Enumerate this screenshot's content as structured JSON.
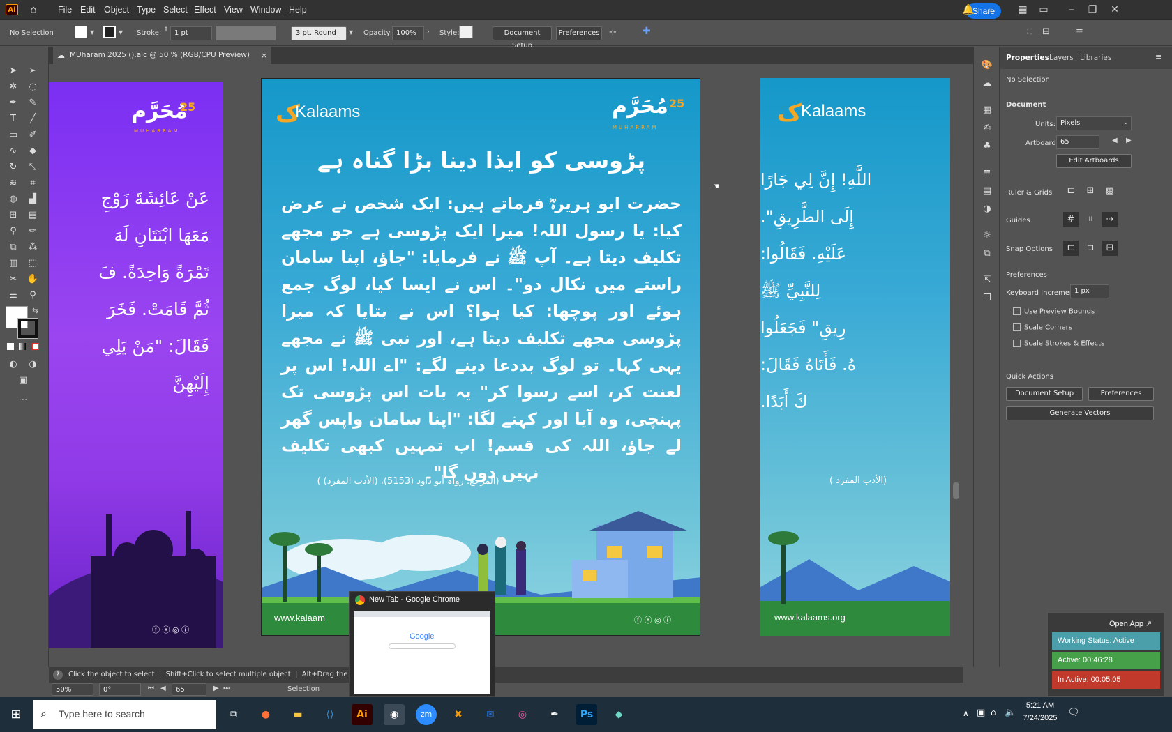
{
  "app": {
    "logo": "Ai",
    "menus": [
      "File",
      "Edit",
      "Object",
      "Type",
      "Select",
      "Effect",
      "View",
      "Window",
      "Help"
    ],
    "share_label": "Share"
  },
  "control": {
    "selection": "No Selection",
    "stroke_label": "Stroke:",
    "stroke_value": "1 pt",
    "brush": "3 pt. Round",
    "opacity_label": "Opacity:",
    "opacity_value": "100%",
    "style_label": "Style:",
    "doc_setup": "Document Setup",
    "preferences": "Preferences"
  },
  "document_tab": {
    "title": "MUharam 2025 ().aic @ 50 % (RGB/CPU Preview)",
    "close": "×"
  },
  "props": {
    "tabs": [
      "Properties",
      "Layers",
      "Libraries"
    ],
    "selection": "No Selection",
    "document": "Document",
    "units_label": "Units:",
    "units_value": "Pixels",
    "artboard_label": "Artboard:",
    "artboard_value": "65",
    "edit_artboards": "Edit Artboards",
    "ruler_grids": "Ruler & Grids",
    "guides": "Guides",
    "snap_options": "Snap Options",
    "preferences": "Preferences",
    "kb_inc_label": "Keyboard Increment:",
    "kb_inc_value": "1 px",
    "use_preview_bounds": "Use Preview Bounds",
    "scale_corners": "Scale Corners",
    "scale_strokes": "Scale Strokes & Effects",
    "quick_actions": "Quick Actions",
    "doc_setup_btn": "Document Setup",
    "prefs_btn": "Preferences",
    "gen_vectors": "Generate Vectors"
  },
  "artboard": {
    "brand": "Kalaams",
    "muharram_num": "25",
    "muharram_ar": "مُحَرَّم",
    "muharram_en": "MUHARRAM",
    "heading": "پڑوسی کو ایذا دینا بڑا گناہ ہے",
    "body": "حضرت ابو ہریرہؓ فرماتے ہیں: ایک شخص نے عرض کیا: یا رسول اللہ! میرا ایک پڑوسی ہے جو مجھے تکلیف دیتا ہے۔ آپ ﷺ نے فرمایا: \"جاؤ، اپنا سامان راستے میں نکال دو\"۔ اس نے ایسا کیا، لوگ جمع ہوئے اور پوچھا: کیا ہوا؟ اس نے بتایا کہ میرا پڑوسی مجھے تکلیف دیتا ہے، اور نبی ﷺ نے مجھے یہی کہا۔ تو لوگ بددعا دینے لگے: \"اے اللہ! اس پر لعنت کر، اسے رسوا کر\" یہ بات اس پڑوسی تک پہنچی، وہ آیا اور کہنے لگا: \"اپنا سامان واپس گھر لے جاؤ، اللہ کی قسم! اب تمہیں کبھی تکلیف نہیں دوں گا\"۔",
    "reference": "(المرجع: رواہ أبو داود (5153)، (الأدب المفرد) )",
    "reference_right": "(الأدب المفرد )",
    "website": "www.kalaams.org",
    "website_mid": "www.kalaam",
    "left_arabic": [
      "عَنْ عَائِشَةَ زَوْجِ",
      "مَعَهَا ابْنَتَانِ لَهَ",
      "تَمْرَةً وَاحِدَةً. فَ",
      "ثُمَّ قَامَتْ. فَخَرَ",
      "فَقَالَ: \"مَنْ يَلِي",
      "إِلَيْهِنَّ"
    ],
    "right_arabic": [
      "اللَّهِ! إِنَّ لِي جَارًا",
      "إِلَى الطَّرِيقِ\".",
      "عَلَيْهِ. فَقَالُوا:",
      "لِلنَّبِيِّ ﷺ",
      "رِيقِ\" فَجَعَلُوا",
      "هُ. فَأَتَاهُ فَقَالَ:",
      "كَ أَبَدًا."
    ]
  },
  "status": {
    "hint": "Click the object to select  |  Shift+Click to select multiple object  |  Alt+Drag the obje",
    "zoom": "50%",
    "rotate": "0°",
    "artboard_num": "65",
    "mode": "Selection"
  },
  "chrome_preview": {
    "title": "New Tab - Google Chrome",
    "google": "Google"
  },
  "tracker": {
    "open_app": "Open App ↗",
    "working": "Working Status: Active",
    "active": "Active: 00:46:28",
    "inactive": "In Active: 00:05:05"
  },
  "taskbar": {
    "search_placeholder": "Type here to search",
    "time": "5:21 AM",
    "date": "7/24/2025"
  },
  "colors": {
    "accent": "#1473e6",
    "artboard_top": "#1598c9",
    "artboard_bottom": "#6cc3d8",
    "purple": "#8a35e0",
    "orange": "#f5a623",
    "green_status": "#46a04a",
    "red_status": "#c0392b",
    "teal_status": "#4a9faa"
  }
}
